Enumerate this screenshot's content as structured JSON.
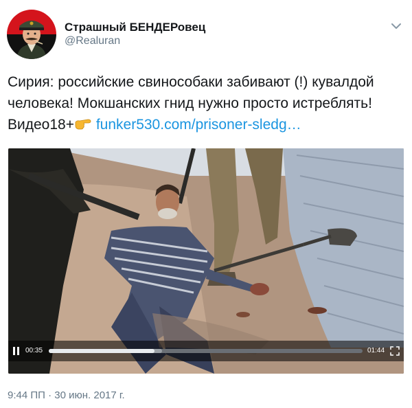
{
  "author": {
    "name": "Страшный БЕНДЕРовец",
    "handle": "@Realuran"
  },
  "tweet": {
    "line1": "Сирия: российские свинособаки забивают (!) кувалдой",
    "line2": "человека! Мокшанских гнид нужно просто истреблять!",
    "line3_prefix": "Видео18+",
    "emoji": "pointing-right-hand-icon",
    "link_text": "funker530.com/prisoner-sledg…"
  },
  "video": {
    "current_time": "00:35",
    "total_time": "01:44",
    "progress_fraction": 0.336,
    "buffer_fraction": 0.36
  },
  "timestamp": "9:44 ПП · 30 июн. 2017 г.",
  "colors": {
    "link": "#1b95e0",
    "secondary_text": "#657786",
    "avatar_bg_red": "#d4141c",
    "avatar_bg_black": "#111111"
  },
  "icons": {
    "menu": "chevron-down-icon",
    "pause": "pause-icon",
    "fullscreen": "fullscreen-icon"
  }
}
